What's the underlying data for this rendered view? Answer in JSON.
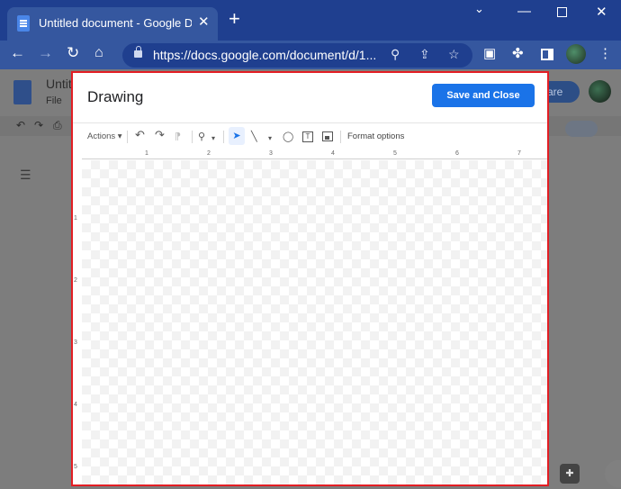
{
  "browser": {
    "tab": {
      "title": "Untitled document - Google Doc",
      "close": "✕"
    },
    "new_tab": "+",
    "window_controls": {
      "chevron": "⌄",
      "minimize": "—",
      "close": "✕"
    },
    "nav": {
      "back": "←",
      "forward": "→",
      "reload": "↻",
      "home": "⌂"
    },
    "url": "https://docs.google.com/document/d/1...",
    "omnibox_icons": {
      "zoom": "⚲",
      "share": "⇪",
      "star": "☆"
    },
    "toolbar_icons": {
      "tab_search": "▣",
      "extensions": "✤",
      "menu": "⋮"
    },
    "colors": {
      "frame": "#1f3f8f",
      "toolbar": "#35579f"
    }
  },
  "docs": {
    "title": "Untit",
    "menu": "File",
    "share_label": "are",
    "outline_icon": "☰",
    "explore_icon": "✚",
    "toolbar_icons": [
      "↶",
      "↷",
      "⎙"
    ],
    "ruler_mark": "1"
  },
  "drawing": {
    "title": "Drawing",
    "save_button": "Save and Close",
    "toolbar": {
      "actions": "Actions ▾",
      "undo": "↶",
      "redo": "↷",
      "paint_format": "⁋",
      "zoom": "⚲",
      "caret": "▾",
      "select": "➤",
      "line": "╲",
      "shape": "◯",
      "textbox": "T",
      "format_options": "Format options"
    },
    "ruler_top_labels": [
      "1",
      "2",
      "3",
      "4",
      "5",
      "6",
      "7"
    ],
    "ruler_left_labels": [
      "1",
      "2",
      "3",
      "4",
      "5"
    ],
    "colors": {
      "accent": "#1a73e8",
      "highlight_border": "#e31e24"
    }
  }
}
